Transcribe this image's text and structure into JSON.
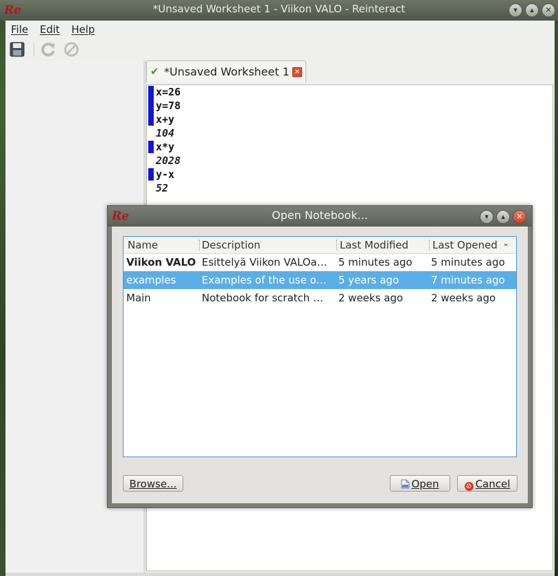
{
  "window": {
    "title": "*Unsaved Worksheet 1 - Viikon VALO - Reinteract",
    "logo": "Re"
  },
  "menubar": {
    "file": "File",
    "edit": "Edit",
    "help": "Help"
  },
  "toolbar": {
    "icons": [
      "save-icon",
      "refresh-icon",
      "stop-icon"
    ]
  },
  "tab": {
    "label": "*Unsaved Worksheet 1",
    "close": "×"
  },
  "worksheet": {
    "lines": [
      {
        "kind": "input",
        "text": "x=26"
      },
      {
        "kind": "input",
        "text": "y=78"
      },
      {
        "kind": "input",
        "text": "x+y"
      },
      {
        "kind": "output",
        "text": "104"
      },
      {
        "kind": "input",
        "text": "x*y"
      },
      {
        "kind": "output",
        "text": "2028"
      },
      {
        "kind": "input",
        "text": "y-x"
      },
      {
        "kind": "output",
        "text": "52"
      }
    ]
  },
  "dialog": {
    "title": "Open Notebook...",
    "logo": "Re",
    "columns": [
      "Name",
      "Description",
      "Last Modified",
      "Last Opened"
    ],
    "rows": [
      {
        "name": "Viikon VALO",
        "description": "Esittelyä Viikon VALOa…",
        "modified": "5 minutes ago",
        "opened": "5 minutes ago",
        "bold": true
      },
      {
        "name": "examples",
        "description": "Examples of the use o…",
        "modified": "5 years ago",
        "opened": "7 minutes ago",
        "selected": true
      },
      {
        "name": "Main",
        "description": "Notebook for scratch …",
        "modified": "2 weeks ago",
        "opened": "2 weeks ago"
      }
    ],
    "browse_label": "Browse...",
    "open_label": "Open",
    "cancel_label": "Cancel"
  },
  "colors": {
    "selection": "#5aaee8",
    "cell_marker": "#1414d8",
    "check": "#3a9a20",
    "close": "#e54a2a"
  }
}
